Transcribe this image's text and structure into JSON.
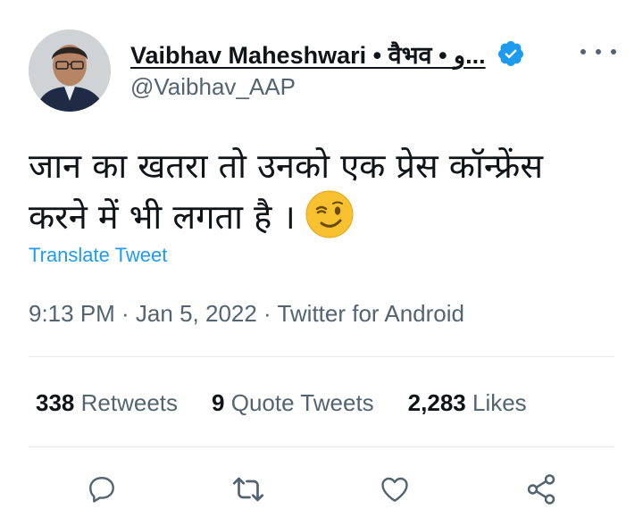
{
  "author": {
    "display_name": "Vaibhav Maheshwari • वैभव • و...",
    "handle": "@Vaibhav_AAP",
    "verified_icon": "verified-badge-icon",
    "more_icon": "more-options-icon"
  },
  "tweet": {
    "text_line1": "जान का खतरा तो उनको एक प्रेस कॉन्फ्रेंस",
    "text_line2": "करने में भी लगता है ।",
    "emoji": "winking-face-emoji",
    "translate_label": "Translate Tweet",
    "timestamp": "9:13 PM · Jan 5, 2022 · Twitter for Android"
  },
  "stats": [
    {
      "count": "338",
      "label": "Retweets"
    },
    {
      "count": "9",
      "label": "Quote Tweets"
    },
    {
      "count": "2,283",
      "label": "Likes"
    }
  ],
  "actions": [
    "reply-icon",
    "retweet-icon",
    "like-icon",
    "share-icon"
  ],
  "colors": {
    "accent": "#1d9bf0",
    "secondary_text": "#536471",
    "divider": "#e6e9eb"
  }
}
